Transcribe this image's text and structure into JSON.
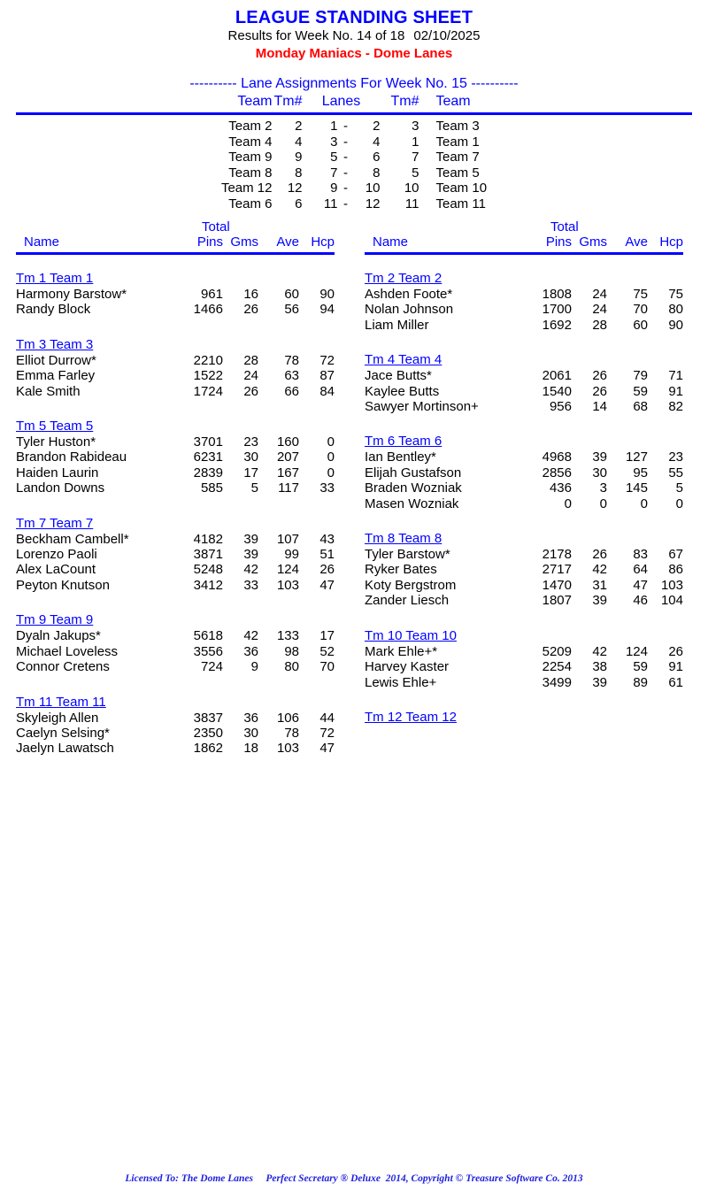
{
  "header": {
    "title": "LEAGUE STANDING SHEET",
    "results_line": "Results for Week No. 14 of 18",
    "results_date": "02/10/2025",
    "league_line": "Monday Maniacs - Dome Lanes",
    "title_color": "#0000FF",
    "league_color": "#FF0000"
  },
  "lane_assignments": {
    "title": "---------- Lane Assignments For Week No. 15 ----------",
    "columns": {
      "team_left": "Team",
      "tmnum_left": "Tm#",
      "lanes": "Lanes",
      "tmnum_right": "Tm#",
      "team_right": "Team"
    },
    "rows": [
      {
        "team_left": "Team 2",
        "tm_left": "2",
        "lane_a": "1",
        "dash": "-",
        "lane_b": "2",
        "tm_right": "3",
        "team_right": "Team 3"
      },
      {
        "team_left": "Team 4",
        "tm_left": "4",
        "lane_a": "3",
        "dash": "-",
        "lane_b": "4",
        "tm_right": "1",
        "team_right": "Team 1"
      },
      {
        "team_left": "Team 9",
        "tm_left": "9",
        "lane_a": "5",
        "dash": "-",
        "lane_b": "6",
        "tm_right": "7",
        "team_right": "Team 7"
      },
      {
        "team_left": "Team 8",
        "tm_left": "8",
        "lane_a": "7",
        "dash": "-",
        "lane_b": "8",
        "tm_right": "5",
        "team_right": "Team 5"
      },
      {
        "team_left": "Team 12",
        "tm_left": "12",
        "lane_a": "9",
        "dash": "-",
        "lane_b": "10",
        "tm_right": "10",
        "team_right": "Team 10"
      },
      {
        "team_left": "Team 6",
        "tm_left": "6",
        "lane_a": "11",
        "dash": "-",
        "lane_b": "12",
        "tm_right": "11",
        "team_right": "Team 11"
      }
    ]
  },
  "roster_columns": {
    "total_word": "Total",
    "name": "Name",
    "pins": "Pins",
    "gms": "Gms",
    "ave": "Ave",
    "hcp": "Hcp"
  },
  "left_column": {
    "teams": [
      {
        "team_label": "Tm 1 Team 1",
        "bowlers": [
          {
            "name": "Harmony Barstow*",
            "pins": "961",
            "gms": "16",
            "ave": "60",
            "hcp": "90"
          },
          {
            "name": "Randy Block",
            "pins": "1466",
            "gms": "26",
            "ave": "56",
            "hcp": "94"
          }
        ]
      },
      {
        "team_label": "Tm 3 Team 3",
        "bowlers": [
          {
            "name": "Elliot Durrow*",
            "pins": "2210",
            "gms": "28",
            "ave": "78",
            "hcp": "72"
          },
          {
            "name": "Emma Farley",
            "pins": "1522",
            "gms": "24",
            "ave": "63",
            "hcp": "87"
          },
          {
            "name": "Kale Smith",
            "pins": "1724",
            "gms": "26",
            "ave": "66",
            "hcp": "84"
          }
        ]
      },
      {
        "team_label": "Tm 5 Team 5",
        "bowlers": [
          {
            "name": "Tyler Huston*",
            "pins": "3701",
            "gms": "23",
            "ave": "160",
            "hcp": "0"
          },
          {
            "name": "Brandon Rabideau",
            "pins": "6231",
            "gms": "30",
            "ave": "207",
            "hcp": "0"
          },
          {
            "name": "Haiden Laurin",
            "pins": "2839",
            "gms": "17",
            "ave": "167",
            "hcp": "0"
          },
          {
            "name": "Landon Downs",
            "pins": "585",
            "gms": "5",
            "ave": "117",
            "hcp": "33"
          }
        ]
      },
      {
        "team_label": "Tm 7 Team 7",
        "bowlers": [
          {
            "name": "Beckham Cambell*",
            "pins": "4182",
            "gms": "39",
            "ave": "107",
            "hcp": "43"
          },
          {
            "name": "Lorenzo Paoli",
            "pins": "3871",
            "gms": "39",
            "ave": "99",
            "hcp": "51"
          },
          {
            "name": "Alex LaCount",
            "pins": "5248",
            "gms": "42",
            "ave": "124",
            "hcp": "26"
          },
          {
            "name": "Peyton Knutson",
            "pins": "3412",
            "gms": "33",
            "ave": "103",
            "hcp": "47"
          }
        ]
      },
      {
        "team_label": "Tm 9 Team 9",
        "bowlers": [
          {
            "name": "Dyaln Jakups*",
            "pins": "5618",
            "gms": "42",
            "ave": "133",
            "hcp": "17"
          },
          {
            "name": "Michael Loveless",
            "pins": "3556",
            "gms": "36",
            "ave": "98",
            "hcp": "52"
          },
          {
            "name": "Connor Cretens",
            "pins": "724",
            "gms": "9",
            "ave": "80",
            "hcp": "70"
          }
        ]
      },
      {
        "team_label": "Tm 11 Team 11",
        "bowlers": [
          {
            "name": "Skyleigh Allen",
            "pins": "3837",
            "gms": "36",
            "ave": "106",
            "hcp": "44"
          },
          {
            "name": "Caelyn Selsing*",
            "pins": "2350",
            "gms": "30",
            "ave": "78",
            "hcp": "72"
          },
          {
            "name": "Jaelyn Lawatsch",
            "pins": "1862",
            "gms": "18",
            "ave": "103",
            "hcp": "47"
          }
        ]
      }
    ]
  },
  "right_column": {
    "teams": [
      {
        "team_label": "Tm 2 Team 2",
        "bowlers": [
          {
            "name": "Ashden Foote*",
            "pins": "1808",
            "gms": "24",
            "ave": "75",
            "hcp": "75"
          },
          {
            "name": "Nolan Johnson",
            "pins": "1700",
            "gms": "24",
            "ave": "70",
            "hcp": "80"
          },
          {
            "name": "Liam Miller",
            "pins": "1692",
            "gms": "28",
            "ave": "60",
            "hcp": "90"
          }
        ]
      },
      {
        "team_label": "Tm 4 Team 4",
        "bowlers": [
          {
            "name": "Jace Butts*",
            "pins": "2061",
            "gms": "26",
            "ave": "79",
            "hcp": "71"
          },
          {
            "name": "Kaylee Butts",
            "pins": "1540",
            "gms": "26",
            "ave": "59",
            "hcp": "91"
          },
          {
            "name": "Sawyer Mortinson+",
            "pins": "956",
            "gms": "14",
            "ave": "68",
            "hcp": "82"
          }
        ]
      },
      {
        "team_label": "Tm 6 Team 6",
        "bowlers": [
          {
            "name": "Ian Bentley*",
            "pins": "4968",
            "gms": "39",
            "ave": "127",
            "hcp": "23"
          },
          {
            "name": "Elijah Gustafson",
            "pins": "2856",
            "gms": "30",
            "ave": "95",
            "hcp": "55"
          },
          {
            "name": "Braden Wozniak",
            "pins": "436",
            "gms": "3",
            "ave": "145",
            "hcp": "5"
          },
          {
            "name": "Masen Wozniak",
            "pins": "0",
            "gms": "0",
            "ave": "0",
            "hcp": "0"
          }
        ]
      },
      {
        "team_label": "Tm 8 Team 8",
        "bowlers": [
          {
            "name": "Tyler Barstow*",
            "pins": "2178",
            "gms": "26",
            "ave": "83",
            "hcp": "67"
          },
          {
            "name": "Ryker Bates",
            "pins": "2717",
            "gms": "42",
            "ave": "64",
            "hcp": "86"
          },
          {
            "name": "Koty Bergstrom",
            "pins": "1470",
            "gms": "31",
            "ave": "47",
            "hcp": "103"
          },
          {
            "name": "Zander Liesch",
            "pins": "1807",
            "gms": "39",
            "ave": "46",
            "hcp": "104"
          }
        ]
      },
      {
        "team_label": "Tm 10 Team 10",
        "bowlers": [
          {
            "name": "Mark Ehle+*",
            "pins": "5209",
            "gms": "42",
            "ave": "124",
            "hcp": "26"
          },
          {
            "name": "Harvey Kaster",
            "pins": "2254",
            "gms": "38",
            "ave": "59",
            "hcp": "91"
          },
          {
            "name": "Lewis Ehle+",
            "pins": "3499",
            "gms": "39",
            "ave": "89",
            "hcp": "61"
          }
        ]
      },
      {
        "team_label": "Tm 12 Team 12",
        "bowlers": []
      }
    ]
  },
  "footer": {
    "text": "Licensed To: The Dome Lanes     Perfect Secretary ® Deluxe  2014, Copyright © Treasure Software Co. 2013"
  }
}
